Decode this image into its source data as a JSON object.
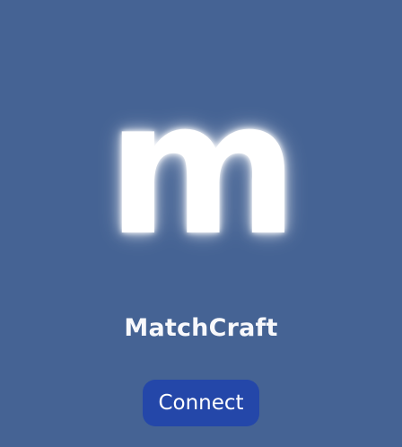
{
  "app": {
    "logo_letter": "m",
    "name": "MatchCraft"
  },
  "actions": {
    "connect_label": "Connect"
  },
  "colors": {
    "background": "#456394",
    "button": "#2447a9",
    "text": "#ffffff"
  }
}
